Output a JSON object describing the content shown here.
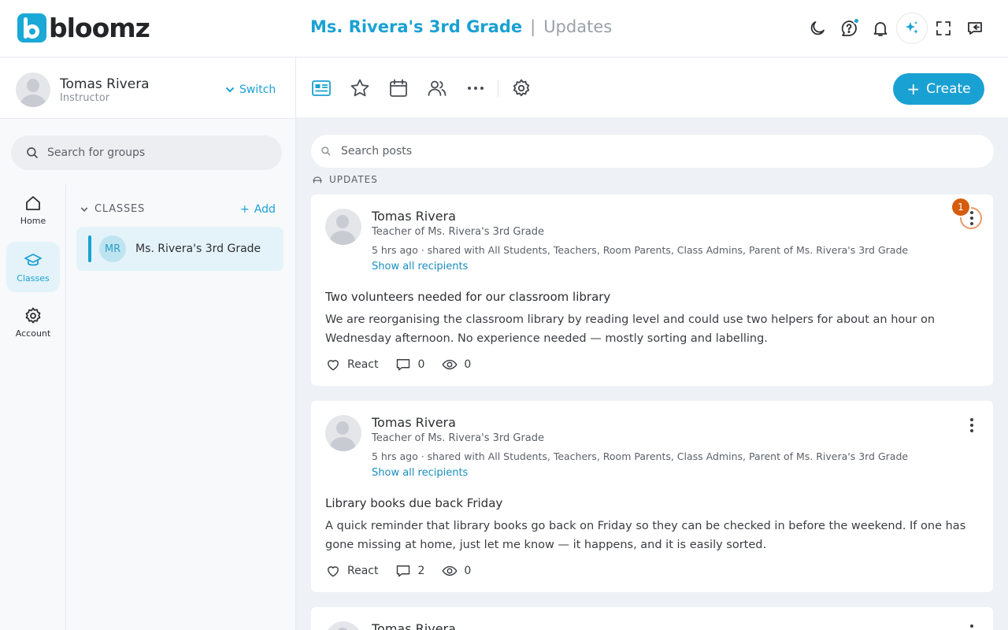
{
  "app": {
    "logo_text": "bloomz"
  },
  "header": {
    "group_name": "Ms. Rivera's 3rd Grade",
    "separator": "|",
    "section": "Updates",
    "icons": [
      "moon-icon",
      "help-chat-icon",
      "bell-icon",
      "ai-sparkle-icon",
      "fullscreen-icon",
      "feedback-icon"
    ]
  },
  "profile": {
    "name": "Tomas Rivera",
    "role": "Instructor",
    "switch_label": "Switch"
  },
  "group_search": {
    "placeholder": "Search for groups"
  },
  "rail": {
    "items": [
      {
        "label": "Home",
        "icon": "home-icon"
      },
      {
        "label": "Classes",
        "icon": "classes-icon",
        "active": true
      },
      {
        "label": "Account",
        "icon": "gear-icon"
      }
    ]
  },
  "classes": {
    "heading": "CLASSES",
    "add_label": "Add",
    "items": [
      {
        "initials": "MR",
        "name": "Ms. Rivera's 3rd Grade"
      }
    ]
  },
  "toolbar": {
    "create_label": "Create",
    "tools": [
      "news-feed-icon",
      "star-icon",
      "calendar-icon",
      "people-icon",
      "more-icon",
      "settings-icon"
    ]
  },
  "post_search": {
    "placeholder": "Search posts"
  },
  "feed_label": "UPDATES",
  "accent_color": "#1aa1d3",
  "posts": [
    {
      "author": "Tomas Rivera",
      "role": "Teacher of Ms. Rivera's 3rd Grade",
      "meta": "5 hrs ago · shared with All Students, Teachers, Room Parents, Class Admins, Parent of Ms. Rivera's 3rd Grade",
      "recipients_link": "Show all recipients",
      "title": "Two volunteers needed for our classroom library",
      "body": "We are reorganising the classroom library by reading level and could use two helpers for about an hour on Wednesday afternoon. No experience needed — mostly sorting and labelling.",
      "react_label": "React",
      "comments": "0",
      "views": "0",
      "badge": "1"
    },
    {
      "author": "Tomas Rivera",
      "role": "Teacher of Ms. Rivera's 3rd Grade",
      "meta": "5 hrs ago · shared with All Students, Teachers, Room Parents, Class Admins, Parent of Ms. Rivera's 3rd Grade",
      "recipients_link": "Show all recipients",
      "title": "Library books due back Friday",
      "body": "A quick reminder that library books go back on Friday so they can be checked in before the weekend. If one has gone missing at home, just let me know — it happens, and it is easily sorted.",
      "react_label": "React",
      "comments": "2",
      "views": "0"
    },
    {
      "author": "Tomas Rivera"
    }
  ]
}
